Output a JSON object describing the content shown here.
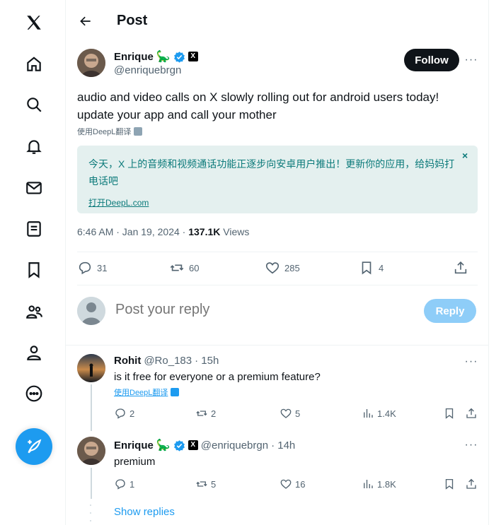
{
  "nav": {
    "items": [
      "x-logo",
      "home",
      "explore",
      "notifications",
      "messages",
      "lists",
      "bookmarks",
      "communities",
      "profile",
      "more"
    ]
  },
  "header": {
    "title": "Post"
  },
  "post": {
    "author_name": "Enrique",
    "author_emoji": "🦕",
    "author_handle": "@enriquebrgn",
    "follow_label": "Follow",
    "text": "audio and video calls on X slowly rolling out for android users today! update your app and call your mother",
    "translate_label": "使用DeepL翻译",
    "translation": {
      "text": "今天，X 上的音频和视频通话功能正逐步向安卓用户推出！更新你的应用，给妈妈打电话吧",
      "open_link": "打开DeepL.com",
      "close": "×"
    },
    "timestamp": "6:46 AM · Jan 19, 2024 · ",
    "views_count": "137.1K",
    "views_label": " Views",
    "stats": {
      "replies": "31",
      "reposts": "60",
      "likes": "285",
      "bookmarks": "4"
    }
  },
  "reply_box": {
    "placeholder": "Post your reply",
    "button_label": "Reply"
  },
  "replies": [
    {
      "name": "Rohit",
      "handle": "@Ro_183",
      "time": "· 15h",
      "text": "is it free for everyone or a premium feature?",
      "translate_label": "使用DeepL翻译",
      "stats": {
        "replies": "2",
        "reposts": "2",
        "likes": "5",
        "views": "1.4K"
      }
    },
    {
      "name": "Enrique",
      "emoji": "🦕",
      "handle": "@enriquebrgn",
      "time": "· 14h",
      "text": "premium",
      "stats": {
        "replies": "1",
        "reposts": "5",
        "likes": "16",
        "views": "1.8K"
      }
    }
  ],
  "show_replies_label": "Show replies",
  "colors": {
    "accent": "#1d9bf0",
    "teal": "#0b7a7a",
    "muted": "#536471"
  }
}
